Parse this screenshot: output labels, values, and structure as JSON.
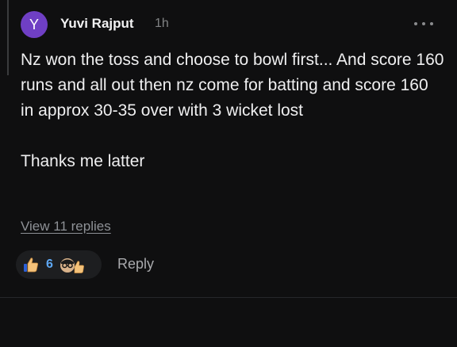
{
  "comment": {
    "avatar_letter": "Y",
    "author": "Yuvi Rajput",
    "time": "1h",
    "paragraphs": [
      "Nz won the toss and choose to bowl first... And score 160 runs and all out then nz come for batting and score 160 in approx 30-35 over with 3 wicket lost",
      "Thanks me latter"
    ],
    "view_replies_label": "View 11 replies",
    "reaction_count": "6",
    "reply_label": "Reply"
  },
  "icons": {
    "menu": "more-horizontal-icon",
    "reaction": "thumbs-up-icon",
    "secondary_reaction": "glasses-thumbs-up-icon"
  },
  "colors": {
    "background": "#0f0f10",
    "avatar": "#6f3fc4",
    "reaction_count": "#5ea8f4",
    "muted": "#818384"
  }
}
